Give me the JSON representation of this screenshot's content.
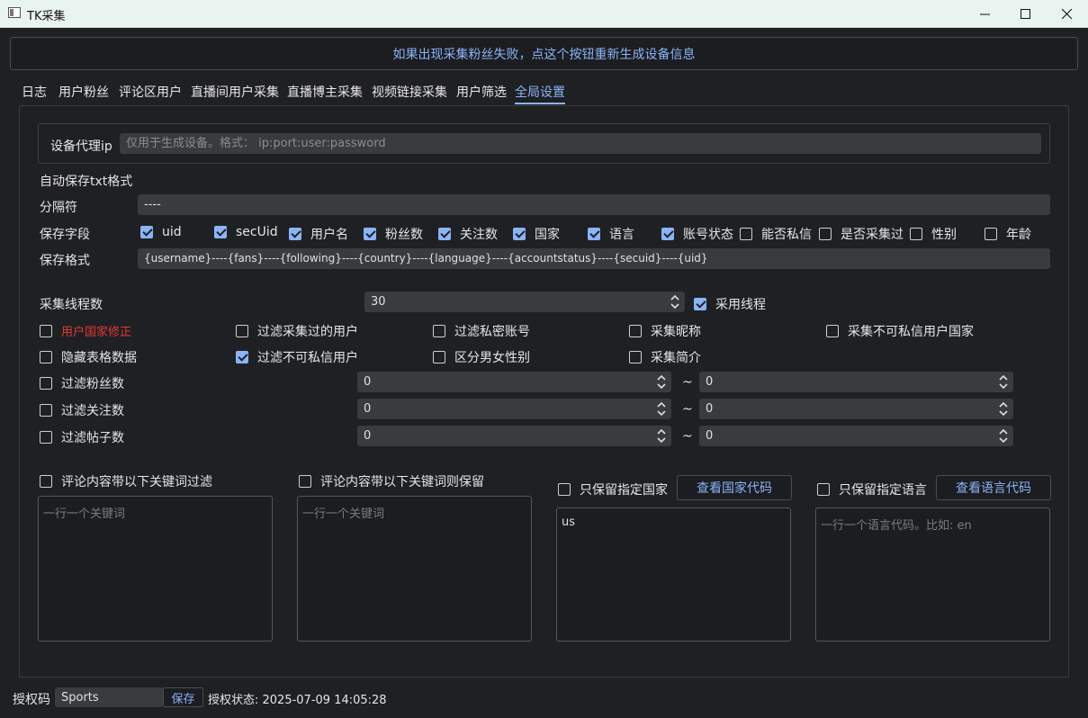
{
  "window": {
    "title": "TK采集"
  },
  "top_button": "如果出现采集粉丝失败，点这个按钮重新生成设备信息",
  "tabs": [
    "日志",
    "用户粉丝",
    "评论区用户",
    "直播间用户采集",
    "直播博主采集",
    "视频链接采集",
    "用户筛选",
    "全局设置"
  ],
  "active_tab": "全局设置",
  "proxy": {
    "label": "设备代理ip",
    "placeholder": "仅用于生成设备。格式：  ip:port:user:password"
  },
  "autosave": {
    "title": "自动保存txt格式",
    "separator_label": "分隔符",
    "separator_value": "----",
    "fields_label": "保存字段",
    "fields": [
      {
        "label": "uid",
        "checked": true
      },
      {
        "label": "secUid",
        "checked": true
      },
      {
        "label": "用户名",
        "checked": true
      },
      {
        "label": "粉丝数",
        "checked": true
      },
      {
        "label": "关注数",
        "checked": true
      },
      {
        "label": "国家",
        "checked": true
      },
      {
        "label": "语言",
        "checked": true
      },
      {
        "label": "账号状态",
        "checked": true
      },
      {
        "label": "能否私信",
        "checked": false
      },
      {
        "label": "是否采集过",
        "checked": false
      },
      {
        "label": "性别",
        "checked": false
      },
      {
        "label": "年龄",
        "checked": false
      }
    ],
    "format_label": "保存格式",
    "format_value": "{username}----{fans}----{following}----{country}----{language}----{accountstatus}----{secuid}----{uid}"
  },
  "threads": {
    "label": "采集线程数",
    "value": "30",
    "use_threads_label": "采用线程",
    "use_threads_checked": true
  },
  "options": [
    {
      "label": "用户国家修正",
      "checked": false,
      "red": true
    },
    {
      "label": "过滤采集过的用户",
      "checked": false
    },
    {
      "label": "过滤私密账号",
      "checked": false
    },
    {
      "label": "采集昵称",
      "checked": false
    },
    {
      "label": "采集不可私信用户国家",
      "checked": false
    },
    {
      "label": "隐藏表格数据",
      "checked": false
    },
    {
      "label": "过滤不可私信用户",
      "checked": true
    },
    {
      "label": "区分男女性别",
      "checked": false
    },
    {
      "label": "采集简介",
      "checked": false
    }
  ],
  "ranges": [
    {
      "label": "过滤粉丝数",
      "checked": false,
      "min": "0",
      "max": "0"
    },
    {
      "label": "过滤关注数",
      "checked": false,
      "min": "0",
      "max": "0"
    },
    {
      "label": "过滤帖子数",
      "checked": false,
      "min": "0",
      "max": "0"
    }
  ],
  "tilde": "~",
  "keyword_filter": {
    "label": "评论内容带以下关键词过滤",
    "checked": false,
    "placeholder": "一行一个关键词"
  },
  "keyword_keep": {
    "label": "评论内容带以下关键词则保留",
    "checked": false,
    "placeholder": "一行一个关键词"
  },
  "country": {
    "label": "只保留指定国家",
    "checked": false,
    "button": "查看国家代码",
    "value": "us"
  },
  "language": {
    "label": "只保留指定语言",
    "checked": false,
    "button": "查看语言代码",
    "placeholder": "一行一个语言代码。比如: en"
  },
  "footer": {
    "auth_label": "授权码",
    "auth_value": "Sports",
    "save_label": "保存",
    "status": "授权状态: 2025-07-09 14:05:28"
  },
  "colors": {
    "accent": "#8ab4f8",
    "background": "#1f2023",
    "warning": "#e53935"
  }
}
